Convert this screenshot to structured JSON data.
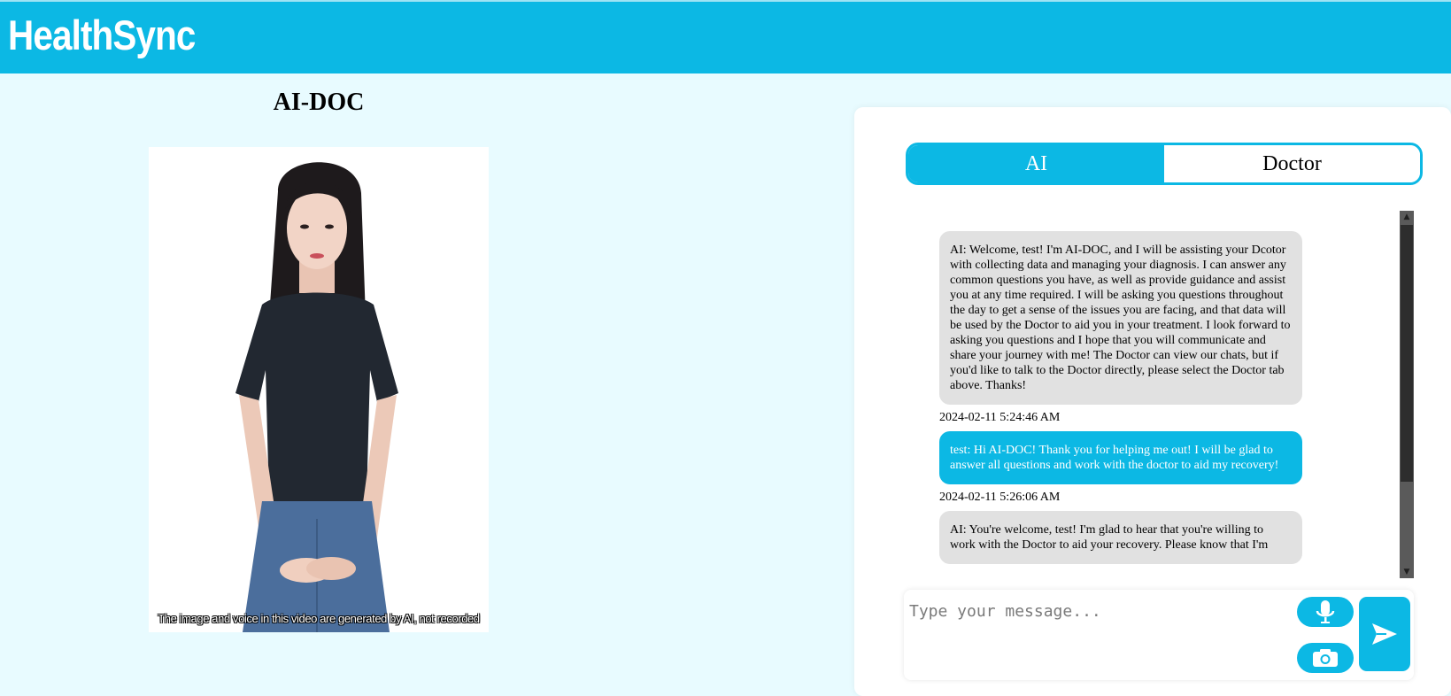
{
  "app": {
    "brand": "HealthSync"
  },
  "left": {
    "title": "AI-DOC",
    "video_caption": "The image and voice in this video are generated by AI, not recorded"
  },
  "tabs": [
    {
      "label": "AI",
      "active": true
    },
    {
      "label": "Doctor",
      "active": false
    }
  ],
  "messages": [
    {
      "sender": "ai",
      "text": "AI: Welcome, test! I'm AI-DOC, and I will be assisting your Dcotor with collecting data and managing your diagnosis. I can answer any common questions you have, as well as provide guidance and assist you at any time required. I will be asking you questions throughout the day to get a sense of the issues you are facing, and that data will be used by the Doctor to aid you in your treatment. I look forward to asking you questions and I hope that you will communicate and share your journey with me! The Doctor can view our chats, but if you'd like to talk to the Doctor directly, please select the Doctor tab above. Thanks!",
      "timestamp": "2024-02-11 5:24:46 AM"
    },
    {
      "sender": "user",
      "text": "test: Hi AI-DOC! Thank you for helping me out! I will be glad to answer all questions and work with the doctor to aid my recovery!",
      "timestamp": "2024-02-11 5:26:06 AM"
    },
    {
      "sender": "ai",
      "text": "AI: You're welcome, test! I'm glad to hear that you're willing to work with the Doctor to aid your recovery. Please know that I'm"
    }
  ],
  "composer": {
    "placeholder": "Type your message..."
  },
  "icons": {
    "mic": "microphone-icon",
    "camera": "camera-icon",
    "send": "send-icon"
  },
  "colors": {
    "accent": "#0cb8e4",
    "page_bg": "#e8fbff",
    "ai_bubble": "#e1e1e1"
  }
}
